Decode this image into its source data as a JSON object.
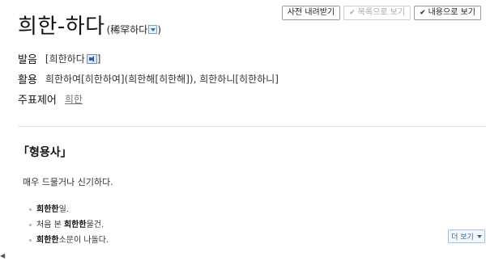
{
  "toolbar": {
    "download_label": "사전 내려받기",
    "list_view_label": "목록으로 보기",
    "content_view_label": "내용으로 보기",
    "check_glyph": "✔"
  },
  "entry": {
    "headword": "희한-하다",
    "hanja": "(稀罕하다",
    "hanja_close": ")"
  },
  "pronunciation": {
    "label": "발음",
    "value": "[희한하다",
    "close": "]"
  },
  "conjugation": {
    "label": "활용",
    "value": "희한하여[히한하여](희한해[히한해]), 희한하니[히한하니]"
  },
  "variant": {
    "label": "주표제어",
    "link": "희한"
  },
  "sense": {
    "pos": "「형용사」",
    "definition": "매우 드물거나 신기하다.",
    "examples": [
      {
        "bold": "희한한",
        "rest": " 일."
      },
      {
        "pre": "처음 본 ",
        "bold": "희한한",
        "rest": " 물건."
      },
      {
        "bold": "희한한",
        "rest": " 소문이 나돌다."
      }
    ]
  },
  "more_label": "더 보기",
  "scroll_left_glyph": "◀"
}
